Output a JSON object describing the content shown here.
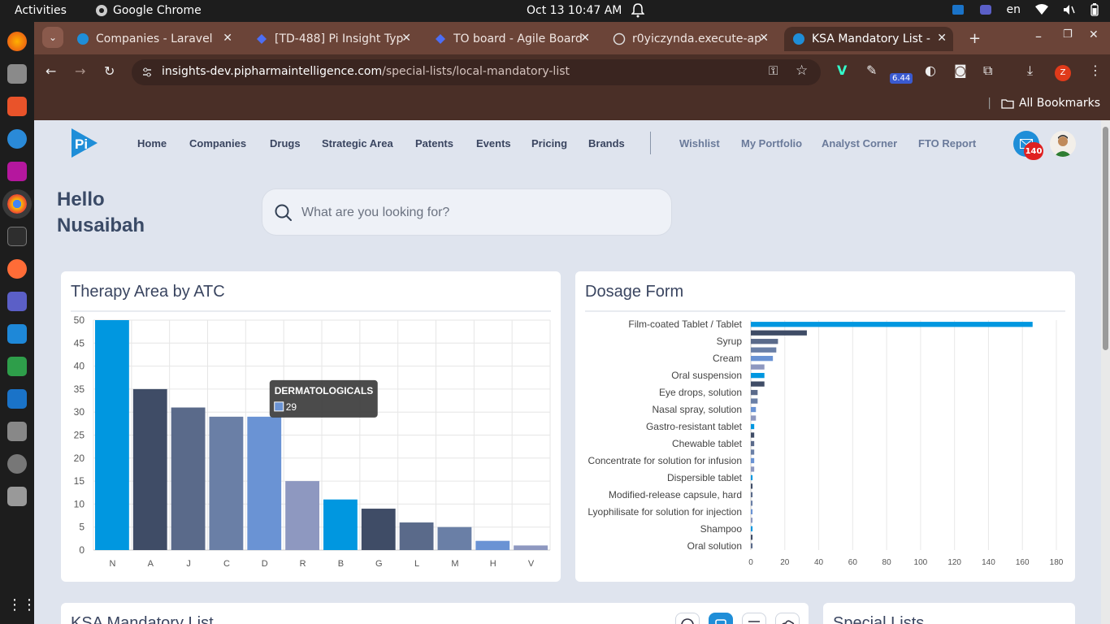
{
  "os": {
    "activities": "Activities",
    "app_name": "Google Chrome",
    "clock": "Oct 13  10:47 AM",
    "lang": "en"
  },
  "browser": {
    "tabs": [
      {
        "title": "Companies - Laravel"
      },
      {
        "title": "[TD-488] Pi Insight Typ"
      },
      {
        "title": "TO board - Agile Board"
      },
      {
        "title": "r0yiczynda.execute-ap"
      },
      {
        "title": "KSA Mandatory List - P"
      }
    ],
    "url_host": "insights-dev.pipharmaintelligence.com",
    "url_path": "/special-lists/local-mandatory-list",
    "ext_badge": "6.44",
    "profile_initial": "Z",
    "bookmarks_label": "All Bookmarks"
  },
  "header": {
    "nav": [
      "Home",
      "Companies",
      "Drugs",
      "Strategic Area",
      "Patents",
      "Events",
      "Pricing",
      "Brands"
    ],
    "nav_secondary": [
      "Wishlist",
      "My Portfolio",
      "Analyst Corner",
      "FTO Report"
    ],
    "messages_count": "140"
  },
  "greeting": {
    "line1": "Hello",
    "line2": "Nusaibah"
  },
  "search": {
    "placeholder": "What are you looking for?"
  },
  "cards": {
    "therapy_title": "Therapy Area by ATC",
    "dosage_title": "Dosage Form",
    "ksa_title": "KSA Mandatory List",
    "special_title": "Special Lists"
  },
  "colors": {
    "accent": "#0097e0",
    "navy": "#3f4c66",
    "slate": "#5a6a8a",
    "steel": "#6a7fa6",
    "cornflower": "#6a93d4",
    "lavender": "#8e98c0"
  },
  "chart_data": [
    {
      "type": "bar",
      "title": "Therapy Area by ATC",
      "categories": [
        "N",
        "A",
        "J",
        "C",
        "D",
        "R",
        "B",
        "G",
        "L",
        "M",
        "H",
        "V"
      ],
      "values": [
        50,
        35,
        31,
        29,
        29,
        15,
        11,
        9,
        6,
        5,
        2,
        1
      ],
      "ylim": [
        0,
        50
      ],
      "yticks": [
        0,
        5,
        10,
        15,
        20,
        25,
        30,
        35,
        40,
        45,
        50
      ],
      "grid": true,
      "tooltip": {
        "label": "DERMATOLOGICALS",
        "value": "29"
      }
    },
    {
      "type": "bar",
      "orientation": "horizontal",
      "title": "Dosage Form",
      "categories": [
        "Film-coated Tablet / Tablet",
        "",
        "Syrup",
        "",
        "Cream",
        "",
        "Oral suspension",
        "",
        "Eye drops, solution",
        "",
        "Nasal spray, solution",
        "",
        "Gastro-resistant tablet",
        "",
        "Chewable tablet",
        "",
        "Concentrate for solution for infusion",
        "",
        "Dispersible tablet",
        "",
        "Modified-release capsule, hard",
        "",
        "Lyophilisate for solution for injection",
        "",
        "Shampoo",
        "",
        "Oral solution"
      ],
      "values": [
        166,
        33,
        16,
        15,
        13,
        8,
        8,
        8,
        4,
        4,
        3,
        3,
        2,
        2,
        2,
        2,
        2,
        2,
        1,
        1,
        1,
        1,
        1,
        1,
        1,
        1,
        1
      ],
      "xlim": [
        0,
        180
      ],
      "xticks": [
        0,
        20,
        40,
        60,
        80,
        100,
        120,
        140,
        160,
        180
      ],
      "grid": true
    }
  ]
}
